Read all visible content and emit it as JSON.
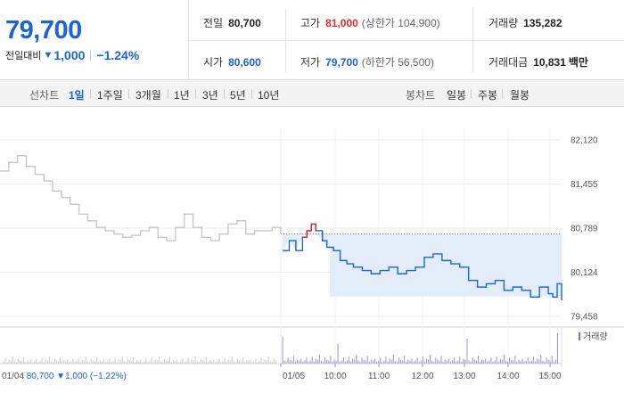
{
  "quote": {
    "price": "79,700",
    "change_label": "전일대비",
    "change_arrow": "▼",
    "change_value": "1,000",
    "change_pct": "−1.24%"
  },
  "stats": {
    "prev_close": {
      "label": "전일",
      "value": "80,700"
    },
    "high": {
      "label": "고가",
      "value": "81,000",
      "sub": "(상한가 104,900)"
    },
    "volume": {
      "label": "거래량",
      "value": "135,282"
    },
    "open": {
      "label": "시가",
      "value": "80,600"
    },
    "low": {
      "label": "저가",
      "value": "79,700",
      "sub": "(하한가 56,500)"
    },
    "amount": {
      "label": "거래대금",
      "value": "10,831",
      "unit": "백만"
    }
  },
  "tabs": {
    "line_label": "선차트",
    "line_periods": [
      "1일",
      "1주일",
      "3개월",
      "1년",
      "3년",
      "5년",
      "10년"
    ],
    "line_active": 0,
    "candle_label": "봉차트",
    "candle_periods": [
      "일봉",
      "주봉",
      "월봉"
    ]
  },
  "colors": {
    "up": "#e02a2a",
    "down": "#1d63d8",
    "prev_day_line": "#c8c8c8",
    "fill": "#e3edf9"
  },
  "chart_data": {
    "type": "line",
    "y_ticks": [
      82120,
      81455,
      80789,
      80124,
      79458
    ],
    "y_tick_labels": [
      "82,120",
      "81,455",
      "80,789",
      "80,124",
      "79,458"
    ],
    "ylim": [
      79458,
      82120
    ],
    "reference_price": 80700,
    "x_tick_labels": [
      "01/05",
      "10:00",
      "11:00",
      "12:00",
      "13:00",
      "14:00",
      "15:00"
    ],
    "volume_label": "거래량",
    "footer_prev": {
      "date": "01/04",
      "price": "80,700",
      "arrow": "▼",
      "change": "1,000",
      "pct": "(−1.22%)"
    },
    "series": [
      {
        "x": [
          0,
          0.2,
          0.4,
          0.6,
          0.8,
          1.0,
          1.2,
          1.4,
          1.6,
          1.8,
          2.0,
          2.2,
          2.4,
          2.6,
          2.8,
          3.0,
          3.2,
          3.4,
          3.6,
          3.8,
          4.0,
          4.2,
          4.4,
          4.6,
          4.8,
          5.0,
          5.2,
          5.4,
          5.6,
          5.8,
          6.0,
          6.2,
          6.4
        ],
        "values": [
          81650,
          81780,
          81880,
          81720,
          81600,
          81500,
          81350,
          81250,
          81150,
          81000,
          80900,
          80800,
          80750,
          80700,
          80650,
          80680,
          80750,
          80800,
          80650,
          80600,
          80800,
          81000,
          80800,
          80650,
          80600,
          80700,
          80850,
          80900,
          80700,
          80750,
          80750,
          80800,
          80700
        ]
      },
      {
        "x": [
          0,
          0.15,
          0.3,
          0.45,
          0.55,
          0.65,
          0.75,
          0.9,
          1.0,
          1.15,
          1.3,
          1.45,
          1.6,
          1.8,
          2.0,
          2.2,
          2.4,
          2.6,
          2.8,
          3.0,
          3.2,
          3.4,
          3.6,
          3.8,
          4.0,
          4.2,
          4.4,
          4.6,
          4.8,
          5.0,
          5.2,
          5.4,
          5.6,
          5.8,
          6.0,
          6.1,
          6.2,
          6.3
        ],
        "values": [
          80450,
          80600,
          80450,
          80650,
          80750,
          80850,
          80750,
          80600,
          80500,
          80450,
          80300,
          80250,
          80200,
          80150,
          80100,
          80150,
          80200,
          80100,
          80150,
          80200,
          80350,
          80400,
          80300,
          80250,
          80200,
          80000,
          79900,
          79950,
          80000,
          79850,
          79900,
          79850,
          79750,
          79900,
          79800,
          79750,
          79950,
          79700
        ]
      }
    ]
  }
}
